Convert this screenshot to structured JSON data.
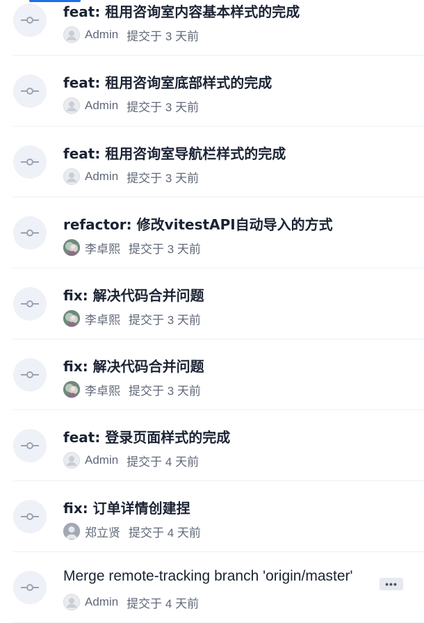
{
  "commits": [
    {
      "title": "feat: 租用咨询室内容基本样式的完成",
      "author": "Admin",
      "avatar": "default",
      "time": "提交于 3 天前"
    },
    {
      "title": "feat: 租用咨询室底部样式的完成",
      "author": "Admin",
      "avatar": "default",
      "time": "提交于 3 天前"
    },
    {
      "title": "feat: 租用咨询室导航栏样式的完成",
      "author": "Admin",
      "avatar": "default",
      "time": "提交于 3 天前"
    },
    {
      "title": "refactor: 修改vitestAPI自动导入的方式",
      "author": "李卓熙",
      "avatar": "photo",
      "time": "提交于 3 天前"
    },
    {
      "title": "fix: 解决代码合并问题",
      "author": "李卓熙",
      "avatar": "photo",
      "time": "提交于 3 天前"
    },
    {
      "title": "fix: 解决代码合并问题",
      "author": "李卓熙",
      "avatar": "photo",
      "time": "提交于 3 天前"
    },
    {
      "title": "feat: 登录页面样式的完成",
      "author": "Admin",
      "avatar": "default",
      "time": "提交于 4 天前"
    },
    {
      "title": "fix: 订单详情创建捏",
      "author": "郑立贤",
      "avatar": "gray",
      "time": "提交于 4 天前"
    },
    {
      "title": "Merge remote-tracking branch 'origin/master'",
      "author": "Admin",
      "avatar": "default",
      "time": "提交于 4 天前",
      "more": "•••"
    }
  ],
  "colors": {
    "accent": "#1f6feb",
    "title": "#1b2333",
    "meta": "#606878",
    "icon_bg": "#eef1f7"
  },
  "icons": {
    "commit": "git-commit-icon",
    "default_avatar": "user-avatar-icon",
    "more": "more-horizontal-icon"
  }
}
